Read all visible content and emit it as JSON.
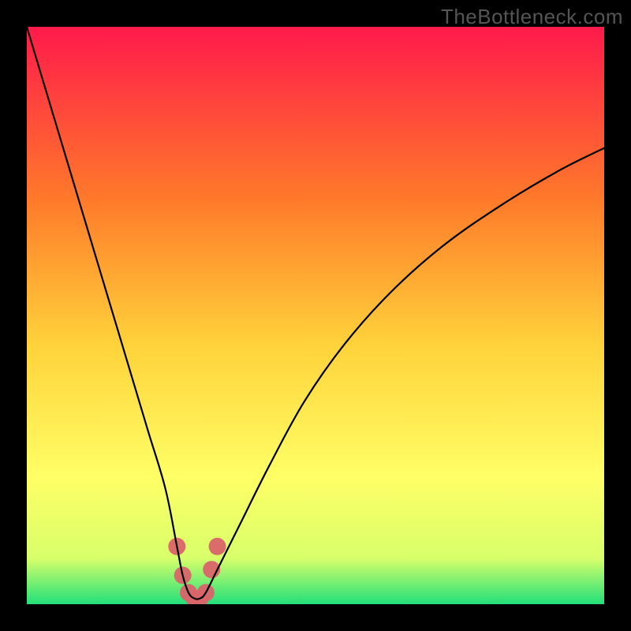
{
  "watermark": "TheBottleneck.com",
  "colors": {
    "frame": "#000000",
    "gradient_top": "#ff1a4b",
    "gradient_mid1": "#ff7a2a",
    "gradient_mid2": "#ffd23a",
    "gradient_mid3": "#ffff66",
    "gradient_mid4": "#d8ff6a",
    "gradient_bottom": "#22e07a",
    "curve": "#000000",
    "marker_red": "#d9646a"
  },
  "chart_data": {
    "type": "line",
    "title": "",
    "xlabel": "",
    "ylabel": "",
    "xlim": [
      0,
      100
    ],
    "ylim": [
      0,
      100
    ],
    "legend": null,
    "annotations": [],
    "curve": {
      "name": "bottleneck-curve",
      "x": [
        0,
        3,
        6,
        9,
        12,
        15,
        18,
        21,
        24,
        26,
        27,
        28,
        29,
        30,
        31,
        33,
        37,
        42,
        48,
        55,
        63,
        72,
        82,
        92,
        100
      ],
      "y": [
        100,
        90,
        80,
        70,
        60,
        50,
        40,
        30,
        20,
        10,
        5,
        2,
        1,
        1,
        2,
        6,
        14,
        24,
        35,
        45,
        54,
        62,
        69,
        75,
        79
      ]
    },
    "marker_cluster": {
      "name": "optimal-points",
      "points": [
        {
          "x": 26,
          "y": 10
        },
        {
          "x": 27,
          "y": 5
        },
        {
          "x": 28,
          "y": 2
        },
        {
          "x": 29,
          "y": 1
        },
        {
          "x": 30,
          "y": 1
        },
        {
          "x": 31,
          "y": 2
        },
        {
          "x": 32,
          "y": 6
        },
        {
          "x": 33,
          "y": 10
        }
      ]
    }
  }
}
